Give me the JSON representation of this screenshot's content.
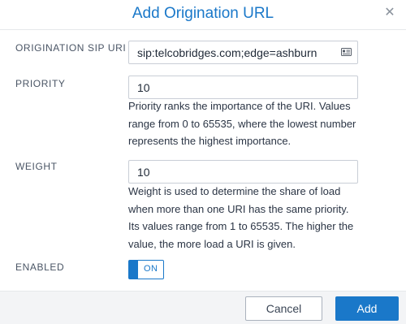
{
  "dialog": {
    "title": "Add Origination URL",
    "close_icon": "close-icon"
  },
  "fields": {
    "sip_uri": {
      "label": "ORIGINATION SIP URI",
      "value": "sip:telcobridges.com;edge=ashburn",
      "icon": "contact-card-icon"
    },
    "priority": {
      "label": "PRIORITY",
      "value": "10",
      "help_lines": [
        "Priority ranks the importance of the URI. Values",
        "range from 0 to 65535, where the lowest number",
        "represents the highest importance."
      ]
    },
    "weight": {
      "label": "WEIGHT",
      "value": "10",
      "help_lines": [
        "Weight is used to determine the share of load",
        "when more than one URI has the same priority.",
        "Its values range from 1 to 65535. The higher the",
        "value, the more load a URI is given."
      ]
    },
    "enabled": {
      "label": "ENABLED",
      "state": "ON"
    }
  },
  "footer": {
    "cancel_label": "Cancel",
    "add_label": "Add"
  },
  "colors": {
    "accent": "#1a78c9",
    "footer_bg": "#f3f4f6"
  }
}
